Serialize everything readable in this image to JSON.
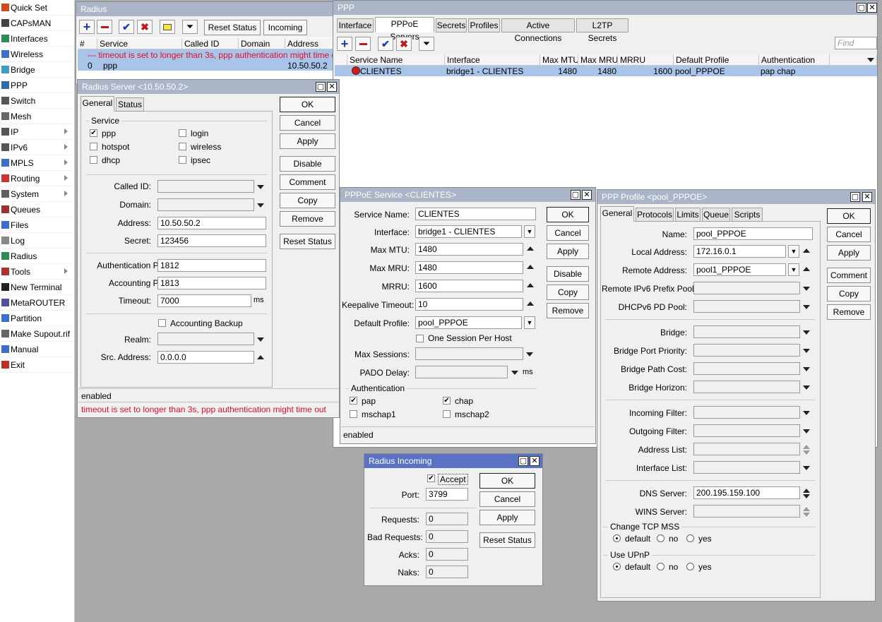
{
  "sidebar": {
    "items": [
      {
        "label": "Quick Set",
        "icon": "quick-set-icon",
        "color": "#d04a1e"
      },
      {
        "label": "CAPsMAN",
        "icon": "capsman-icon",
        "color": "#444444"
      },
      {
        "label": "Interfaces",
        "icon": "interfaces-icon",
        "color": "#2e8b57"
      },
      {
        "label": "Wireless",
        "icon": "wireless-icon",
        "color": "#3a6fd0"
      },
      {
        "label": "Bridge",
        "icon": "bridge-icon",
        "color": "#3aa0c0"
      },
      {
        "label": "PPP",
        "icon": "ppp-icon",
        "color": "#2d6ab0"
      },
      {
        "label": "Switch",
        "icon": "switch-icon",
        "color": "#555555"
      },
      {
        "label": "Mesh",
        "icon": "mesh-icon",
        "color": "#666666"
      },
      {
        "label": "IP",
        "icon": "ip-icon",
        "color": "#555555",
        "sub": true
      },
      {
        "label": "IPv6",
        "icon": "ipv6-icon",
        "color": "#555555",
        "sub": true
      },
      {
        "label": "MPLS",
        "icon": "mpls-icon",
        "color": "#3a6fd0",
        "sub": true
      },
      {
        "label": "Routing",
        "icon": "routing-icon",
        "color": "#d03030",
        "sub": true
      },
      {
        "label": "System",
        "icon": "system-icon",
        "color": "#606060",
        "sub": true
      },
      {
        "label": "Queues",
        "icon": "queues-icon",
        "color": "#a03030"
      },
      {
        "label": "Files",
        "icon": "files-icon",
        "color": "#3a6fd0"
      },
      {
        "label": "Log",
        "icon": "log-icon",
        "color": "#888888"
      },
      {
        "label": "Radius",
        "icon": "radius-icon",
        "color": "#2e8b57"
      },
      {
        "label": "Tools",
        "icon": "tools-icon",
        "color": "#b03030",
        "sub": true
      },
      {
        "label": "New Terminal",
        "icon": "terminal-icon",
        "color": "#222222"
      },
      {
        "label": "MetaROUTER",
        "icon": "metarouter-icon",
        "color": "#5050a0"
      },
      {
        "label": "Partition",
        "icon": "partition-icon",
        "color": "#3a6fd0"
      },
      {
        "label": "Make Supout.rif",
        "icon": "supout-icon",
        "color": "#666666"
      },
      {
        "label": "Manual",
        "icon": "manual-icon",
        "color": "#3a6fd0"
      },
      {
        "label": "Exit",
        "icon": "exit-icon",
        "color": "#c03020"
      }
    ]
  },
  "radius": {
    "title": "Radius",
    "reset_status": "Reset Status",
    "incoming": "Incoming",
    "columns": [
      "#",
      "Service",
      "Called ID",
      "Domain",
      "Address"
    ],
    "warning": "--- timeout is set to longer than 3s, ppp authentication might time out",
    "row": {
      "num": "0",
      "service": "ppp",
      "called_id": "",
      "domain": "",
      "address": "10.50.50.2"
    }
  },
  "radius_server": {
    "title": "Radius Server <10.50.50.2>",
    "tabs": [
      "General",
      "Status"
    ],
    "service_group": "Service",
    "services": [
      {
        "label": "ppp",
        "checked": true
      },
      {
        "label": "login",
        "checked": false
      },
      {
        "label": "hotspot",
        "checked": false
      },
      {
        "label": "wireless",
        "checked": false
      },
      {
        "label": "dhcp",
        "checked": false
      },
      {
        "label": "ipsec",
        "checked": false
      }
    ],
    "fields": {
      "called_id": "Called ID:",
      "domain": "Domain:",
      "address": "Address:",
      "secret": "Secret:",
      "auth_port": "Authentication Port:",
      "acct_port": "Accounting Port:",
      "timeout": "Timeout:",
      "realm": "Realm:",
      "src_address": "Src. Address:"
    },
    "values": {
      "called_id": "",
      "domain": "",
      "address": "10.50.50.2",
      "secret": "123456",
      "auth_port": "1812",
      "acct_port": "1813",
      "timeout": "7000",
      "realm": "",
      "src_address": "0.0.0.0"
    },
    "timeout_unit": "ms",
    "accounting_backup": "Accounting Backup",
    "buttons": [
      "OK",
      "Cancel",
      "Apply",
      "Disable",
      "Comment",
      "Copy",
      "Remove",
      "Reset Status"
    ],
    "status": "enabled",
    "warning": "timeout is set to longer than 3s, ppp authentication might time out"
  },
  "ppp": {
    "title": "PPP",
    "tabs": [
      "Interface",
      "PPPoE Servers",
      "Secrets",
      "Profiles",
      "Active Connections",
      "L2TP Secrets"
    ],
    "find_placeholder": "Find",
    "columns": [
      "Service Name",
      "Interface",
      "Max MTU",
      "Max MRU",
      "MRRU",
      "Default Profile",
      "Authentication"
    ],
    "row": {
      "service": "CLIENTES",
      "interface": "bridge1 - CLIENTES",
      "mtu": "1480",
      "mru": "1480",
      "mrru": "1600",
      "profile": "pool_PPPOE",
      "auth": "pap chap"
    }
  },
  "pppoe": {
    "title": "PPPoE Service <CLIENTES>",
    "fields": {
      "service": "Service Name:",
      "interface": "Interface:",
      "mtu": "Max MTU:",
      "mru": "Max MRU:",
      "mrru": "MRRU:",
      "keepalive": "Keepalive Timeout:",
      "profile": "Default Profile:",
      "max_sessions": "Max Sessions:",
      "pado": "PADO Delay:"
    },
    "values": {
      "service": "CLIENTES",
      "interface": "bridge1 - CLIENTES",
      "mtu": "1480",
      "mru": "1480",
      "mrru": "1600",
      "keepalive": "10",
      "profile": "pool_PPPOE",
      "max_sessions": "",
      "pado": ""
    },
    "pado_unit": "ms",
    "one_session": "One Session Per Host",
    "auth_group": "Authentication",
    "auth": [
      {
        "label": "pap",
        "checked": true
      },
      {
        "label": "chap",
        "checked": true
      },
      {
        "label": "mschap1",
        "checked": false
      },
      {
        "label": "mschap2",
        "checked": false
      }
    ],
    "buttons": [
      "OK",
      "Cancel",
      "Apply",
      "Disable",
      "Copy",
      "Remove"
    ],
    "status": "enabled"
  },
  "profile": {
    "title": "PPP Profile <pool_PPPOE>",
    "tabs": [
      "General",
      "Protocols",
      "Limits",
      "Queue",
      "Scripts"
    ],
    "fields": {
      "name": "Name:",
      "local": "Local Address:",
      "remote": "Remote Address:",
      "ipv6pool": "Remote IPv6 Prefix Pool:",
      "dhcpv6": "DHCPv6 PD Pool:",
      "bridge": "Bridge:",
      "bpp": "Bridge Port Priority:",
      "bpc": "Bridge Path Cost:",
      "bh": "Bridge Horizon:",
      "infilter": "Incoming Filter:",
      "outfilter": "Outgoing Filter:",
      "addrlist": "Address List:",
      "iflist": "Interface List:",
      "dns": "DNS Server:",
      "wins": "WINS Server:"
    },
    "values": {
      "name": "pool_PPPOE",
      "local": "172.16.0.1",
      "remote": "pool1_PPPOE",
      "dns": "200.195.159.100"
    },
    "tcp_mss": "Change TCP MSS",
    "upnp": "Use UPnP",
    "radio_options": [
      "default",
      "no",
      "yes"
    ],
    "buttons": [
      "OK",
      "Cancel",
      "Apply",
      "Comment",
      "Copy",
      "Remove"
    ]
  },
  "incoming": {
    "title": "Radius Incoming",
    "accept": "Accept",
    "fields": {
      "port": "Port:",
      "requests": "Requests:",
      "bad": "Bad Requests:",
      "acks": "Acks:",
      "naks": "Naks:"
    },
    "values": {
      "port": "3799",
      "requests": "0",
      "bad": "0",
      "acks": "0",
      "naks": "0"
    },
    "buttons": [
      "OK",
      "Cancel",
      "Apply",
      "Reset Status"
    ]
  }
}
